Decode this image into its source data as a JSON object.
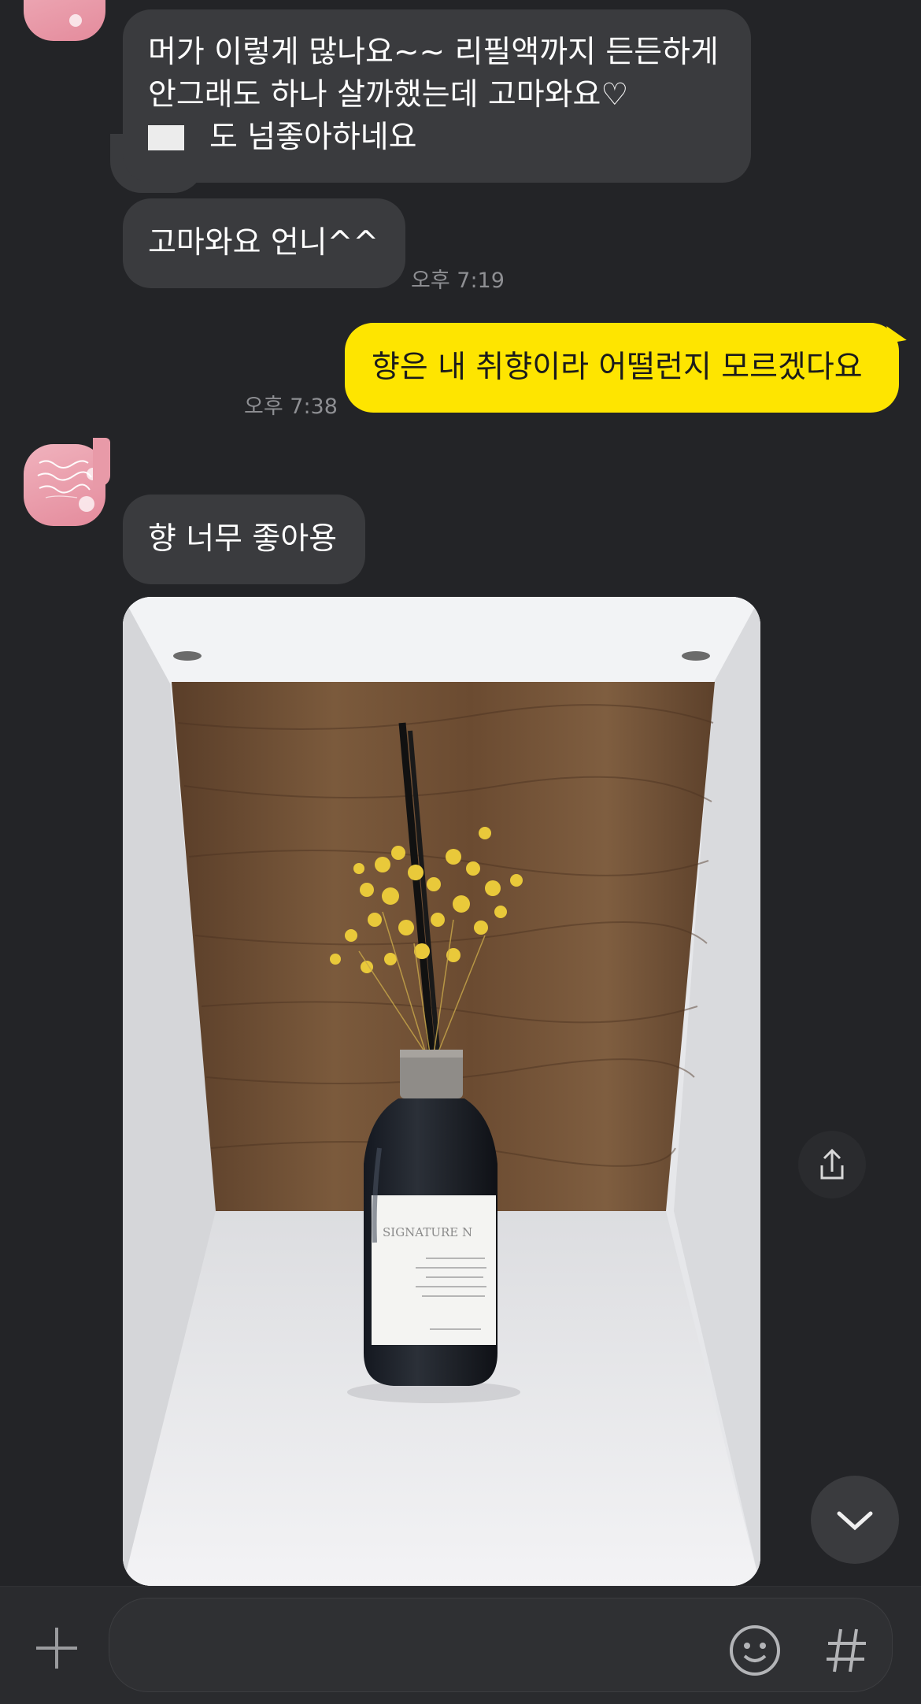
{
  "messages": {
    "msg1_lines": [
      "머가 이렇게 많나요~~ 리필액까지 든든하게",
      "안그래도 하나 살까했는데 고마와요♡",
      "도 넘좋아하네요"
    ],
    "msg2": "고마와요 언니^^",
    "msg2_time": "오후 7:19",
    "my_msg": "향은 내 취향이라 어떨런지 모르겠다요",
    "my_msg_time": "오후 7:38",
    "msg3": "향 너무 좋아용"
  },
  "photo": {
    "label_text": "SIGNATURE N",
    "subject": "diffuser bottle with yellow dried flowers"
  },
  "icons": {
    "share": "share-icon",
    "scroll_down": "chevron-down-icon",
    "plus": "plus-icon",
    "emoji": "emoji-icon",
    "hashtag": "hashtag-icon"
  },
  "colors": {
    "background": "#232427",
    "bubble_other": "#3a3b3e",
    "bubble_mine": "#fee500",
    "timestamp": "#8e8f93",
    "avatar": "#e89aa8"
  }
}
